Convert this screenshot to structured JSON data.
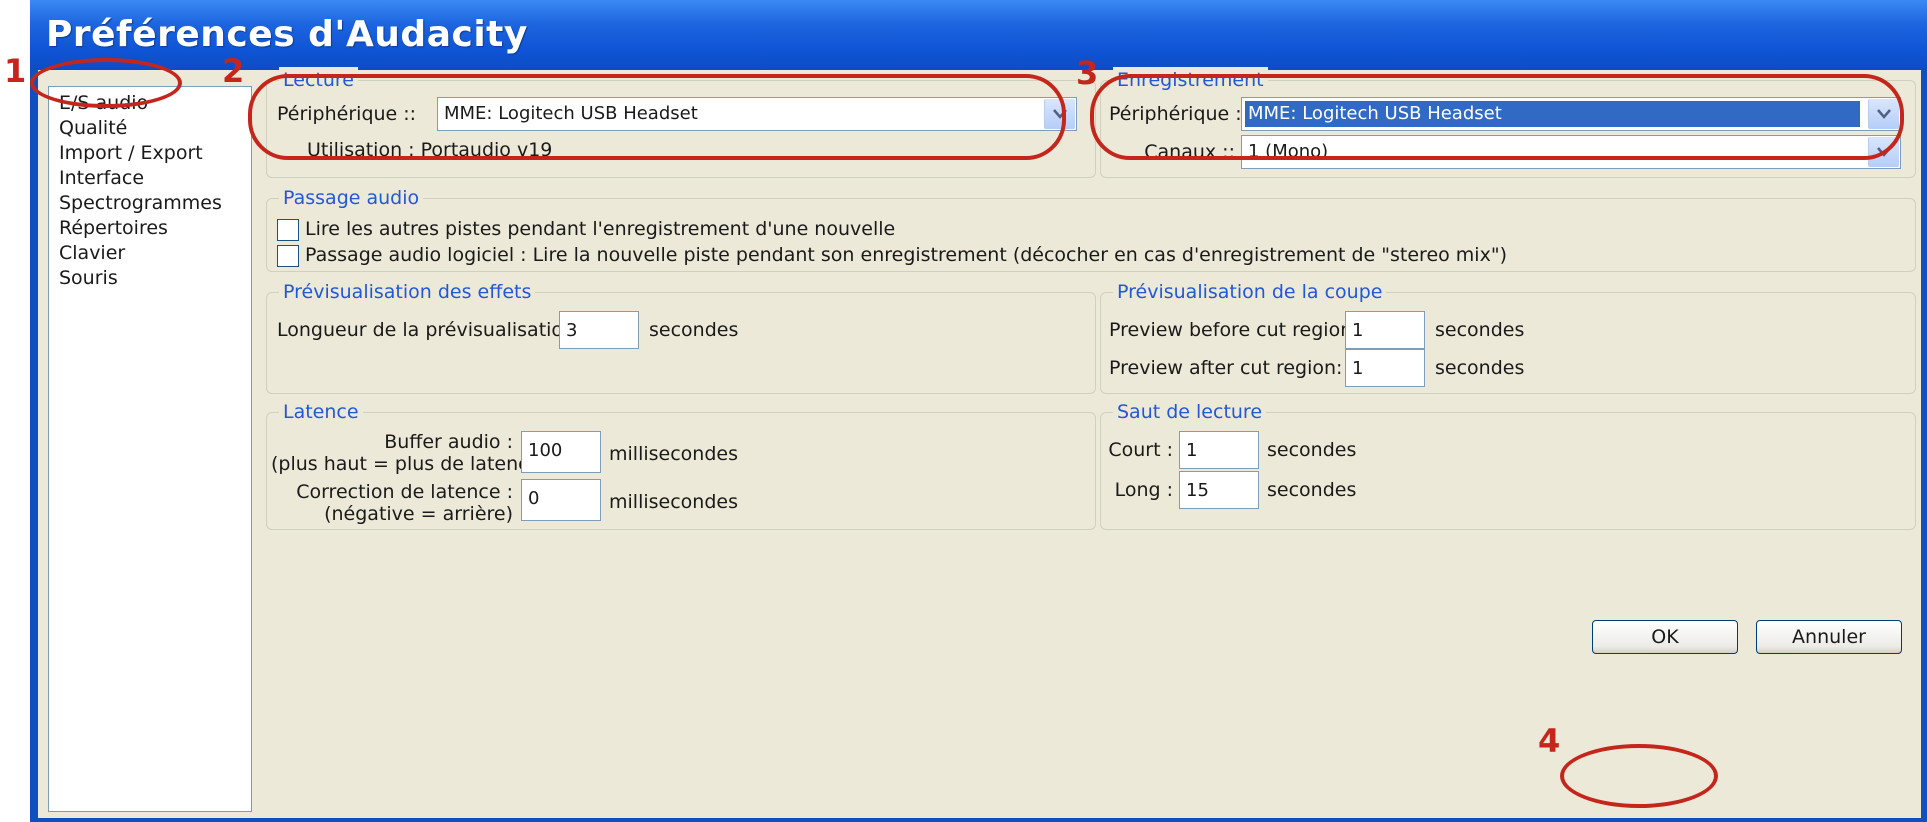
{
  "window": {
    "title": "Préférences d'Audacity"
  },
  "sidebar": {
    "items": [
      {
        "label": "E/S audio"
      },
      {
        "label": "Qualité"
      },
      {
        "label": "Import / Export"
      },
      {
        "label": "Interface"
      },
      {
        "label": "Spectrogrammes"
      },
      {
        "label": "Répertoires"
      },
      {
        "label": "Clavier"
      },
      {
        "label": "Souris"
      }
    ]
  },
  "lecture": {
    "legend": "Lecture",
    "device_label": "Périphérique ::",
    "device_value": "MME: Logitech USB Headset",
    "usage_label": "Utilisation : Portaudio v19"
  },
  "enregistrement": {
    "legend": "Enregistrement",
    "device_label": "Périphérique ::",
    "device_value": "MME: Logitech USB Headset",
    "channels_label": "Canaux ::",
    "channels_value": "1 (Mono)"
  },
  "passage": {
    "legend": "Passage audio",
    "option1": "Lire les autres pistes pendant l'enregistrement d'une nouvelle",
    "option2": "Passage audio logiciel : Lire la nouvelle piste pendant son enregistrement (décocher en cas d'enregistrement de \"stereo mix\")"
  },
  "effects_preview": {
    "legend": "Prévisualisation des effets",
    "length_label": "Longueur de la prévisualisation :",
    "length_value": "3",
    "unit": "secondes"
  },
  "cut_preview": {
    "legend": "Prévisualisation de la coupe",
    "before_label": "Preview before cut region:",
    "before_value": "1",
    "after_label": "Preview after cut region:",
    "after_value": "1",
    "unit": "secondes"
  },
  "latency": {
    "legend": "Latence",
    "buffer_label_1": "Buffer audio :",
    "buffer_label_2": "(plus haut = plus de latence)",
    "buffer_value": "100",
    "correction_label_1": "Correction de latence :",
    "correction_label_2": "(négative = arrière)",
    "correction_value": "0",
    "unit": "millisecondes"
  },
  "seek": {
    "legend": "Saut de lecture",
    "short_label": "Court :",
    "short_value": "1",
    "long_label": "Long :",
    "long_value": "15",
    "unit": "secondes"
  },
  "buttons": {
    "ok": "OK",
    "cancel": "Annuler"
  },
  "annotations": {
    "n1": "1",
    "n2": "2",
    "n3": "3",
    "n4": "4"
  },
  "colors": {
    "annotation": "#c4261c",
    "legend": "#2158d8",
    "titlebar": "#0f55d6"
  }
}
